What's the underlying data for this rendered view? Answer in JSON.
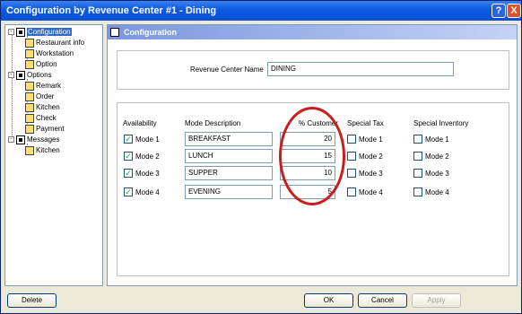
{
  "window": {
    "title": "Configuration by Revenue Center #1 - Dining",
    "help_label": "?",
    "close_label": "X"
  },
  "tree": {
    "configuration": "Configuration",
    "restaurant_info": "Restaurant info",
    "workstation": "Workstation",
    "option": "Option",
    "options": "Options",
    "remark": "Remark",
    "order": "Order",
    "kitchen": "Kitchen",
    "check": "Check",
    "payment": "Payment",
    "messages": "Messages",
    "msg_kitchen": "Kitchen",
    "expander": "-"
  },
  "panel": {
    "title": "Configuration",
    "revenue_center_label": "Revenue Center Name",
    "revenue_center_value": "DINING",
    "headers": {
      "availability": "Availability",
      "mode_description": "Mode Description",
      "percent_customer": "% Customer",
      "special_tax": "Special Tax",
      "special_inventory": "Special Inventory"
    },
    "rows": [
      {
        "mode": "Mode 1",
        "description": "BREAKFAST",
        "percent": "20",
        "available": true
      },
      {
        "mode": "Mode 2",
        "description": "LUNCH",
        "percent": "15",
        "available": true
      },
      {
        "mode": "Mode 3",
        "description": "SUPPER",
        "percent": "10",
        "available": true
      },
      {
        "mode": "Mode 4",
        "description": "EVENING",
        "percent": "5",
        "available": true
      }
    ],
    "check_mark": "✓"
  },
  "buttons": {
    "delete": "Delete",
    "ok": "OK",
    "cancel": "Cancel",
    "apply": "Apply"
  }
}
